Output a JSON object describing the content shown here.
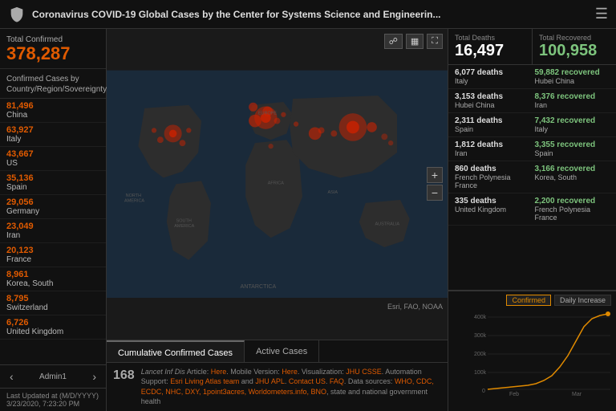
{
  "header": {
    "title": "Coronavirus COVID-19 Global Cases by the Center for Systems Science and Engineerin...",
    "icon": "shield"
  },
  "sidebar": {
    "total_confirmed_label": "Total Confirmed",
    "total_confirmed_value": "378,287",
    "country_list_header": "Confirmed Cases by Country/Region/Sovereignty",
    "countries": [
      {
        "count": "81,496",
        "name": "China"
      },
      {
        "count": "63,927",
        "name": "Italy"
      },
      {
        "count": "43,667",
        "name": "US"
      },
      {
        "count": "35,136",
        "name": "Spain"
      },
      {
        "count": "29,056",
        "name": "Germany"
      },
      {
        "count": "23,049",
        "name": "Iran"
      },
      {
        "count": "20,123",
        "name": "France"
      },
      {
        "count": "8,961",
        "name": "Korea, South"
      },
      {
        "count": "8,795",
        "name": "Switzerland"
      },
      {
        "count": "6,726",
        "name": "United Kingdom"
      }
    ],
    "admin_label": "Admin1",
    "last_updated_label": "Last Updated at (M/D/YYYY)",
    "last_updated_value": "3/23/2020, 7:23:20 PM"
  },
  "map": {
    "tabs": [
      {
        "label": "Cumulative Confirmed Cases",
        "active": true
      },
      {
        "label": "Active Cases",
        "active": false
      }
    ],
    "attribution": "Esri, FAO, NOAA",
    "toolbar_icons": [
      "bookmark",
      "grid",
      "fullscreen"
    ]
  },
  "info_bar": {
    "count": "168",
    "text": "Lancet Inf Dis Article: Here. Mobile Version: Here. Visualization: JHU CSSE. Automation Support: Esri Living Atlas team and JHU APL. Contact US. FAQ. Data sources: WHO, CDC, ECDC, NHC, DXY, 1point3acres, Worldometers.info, BNO, state and national government health"
  },
  "right_panel": {
    "total_deaths_label": "Total Deaths",
    "total_deaths_value": "16,497",
    "total_recovered_label": "Total Recovered",
    "total_recovered_value": "100,958",
    "deaths": [
      {
        "count": "6,077 deaths",
        "name": "Italy",
        "recovered_count": "59,882 recovered",
        "recovered_name": "Hubei China"
      },
      {
        "count": "3,153 deaths",
        "name": "Hubei China",
        "recovered_count": "8,376 recovered",
        "recovered_name": "Iran"
      },
      {
        "count": "2,311 deaths",
        "name": "Spain",
        "recovered_count": "7,432 recovered",
        "recovered_name": "Italy"
      },
      {
        "count": "1,812 deaths",
        "name": "Iran",
        "recovered_count": "3,355 recovered",
        "recovered_name": "Spain"
      },
      {
        "count": "860 deaths",
        "name": "French Polynesia France",
        "recovered_count": "3,166 recovered",
        "recovered_name": "Korea, South"
      },
      {
        "count": "335 deaths",
        "name": "United Kingdom",
        "recovered_count": "2,200 recovered",
        "recovered_name": "French Polynesia France"
      }
    ],
    "chart": {
      "tabs": [
        "Confirmed",
        "Daily Increase"
      ],
      "active_tab": "Confirmed",
      "x_labels": [
        "Feb",
        "Mar"
      ],
      "y_labels": [
        "400k",
        "300k",
        "200k",
        "100k",
        "0"
      ]
    }
  }
}
